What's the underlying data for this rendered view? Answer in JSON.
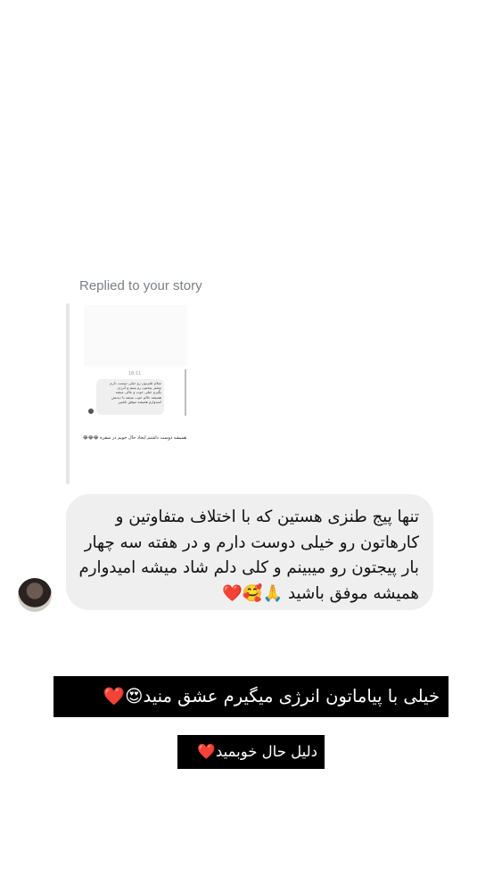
{
  "reply_header": "Replied to your story",
  "story_thumbnail": {
    "time": "18:11",
    "bubble_lines": [
      "سلام طنزتون رو خیلی دوست دارم",
      "بیشتر پیجتون رو ببینم و انرژی",
      "بگیرم خیلی خوب و عالی میشه",
      "همیشه حالم خوب میشه با دیدنش",
      "امیدوارم همیشه موفق باشین"
    ],
    "caption": "همیشه دوست داشتم ایجاد حال خوبم در سفره 😂😂😂"
  },
  "message": {
    "text": "تنها پیج طنزی هستین که با اختلاف متفاوتین و کارهاتون رو خیلی دوست دارم و در هفته سه چهار بار پیجتون رو میبینم و کلی دلم شاد میشه امیدوارم همیشه موفق باشید 🙏🥰❤️"
  },
  "captions": {
    "line1": "خیلی با پیاماتون انرژی میگیرم عشق منید😍❤️",
    "line2": "دلیل حال خوبمید❤️"
  }
}
